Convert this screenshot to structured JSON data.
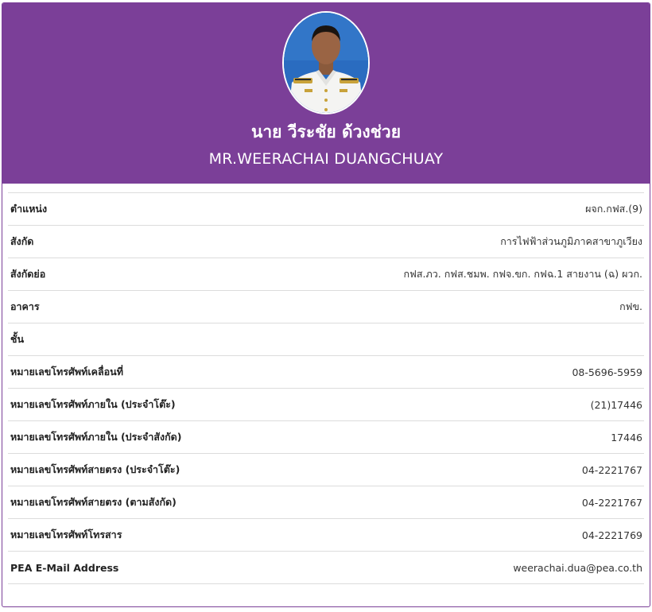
{
  "profile": {
    "name_th": "นาย วีระชัย ด้วงช่วย",
    "name_en": "MR.WEERACHAI DUANGCHUAY"
  },
  "fields": [
    {
      "label": "ตำแหน่ง",
      "value": "ผจก.กฟส.(9)"
    },
    {
      "label": "สังกัด",
      "value": "การไฟฟ้าส่วนภูมิภาคสาขาภูเวียง"
    },
    {
      "label": "สังกัดย่อ",
      "value": "กฟส.ภว. กฟส.ชมพ. กฟจ.ขก. กฟฉ.1 สายงาน (ฉ) ผวก."
    },
    {
      "label": "อาคาร",
      "value": "กฟข."
    },
    {
      "label": "ชั้น",
      "value": ""
    },
    {
      "label": "หมายเลขโทรศัพท์เคลื่อนที่",
      "value": "08-5696-5959"
    },
    {
      "label": "หมายเลขโทรศัพท์ภายใน (ประจำโต๊ะ)",
      "value": "(21)17446"
    },
    {
      "label": "หมายเลขโทรศัพท์ภายใน (ประจำสังกัด)",
      "value": "17446"
    },
    {
      "label": "หมายเลขโทรศัพท์สายตรง (ประจำโต๊ะ)",
      "value": "04-2221767"
    },
    {
      "label": "หมายเลขโทรศัพท์สายตรง (ตามสังกัด)",
      "value": "04-2221767"
    },
    {
      "label": "หมายเลขโทรศัพท์โทรสาร",
      "value": "04-2221769"
    },
    {
      "label": "PEA E-Mail Address",
      "value": "weerachai.dua@pea.co.th"
    }
  ],
  "colors": {
    "header_bg": "#7b3f98",
    "avatar_bg": "#1e5fb0"
  }
}
